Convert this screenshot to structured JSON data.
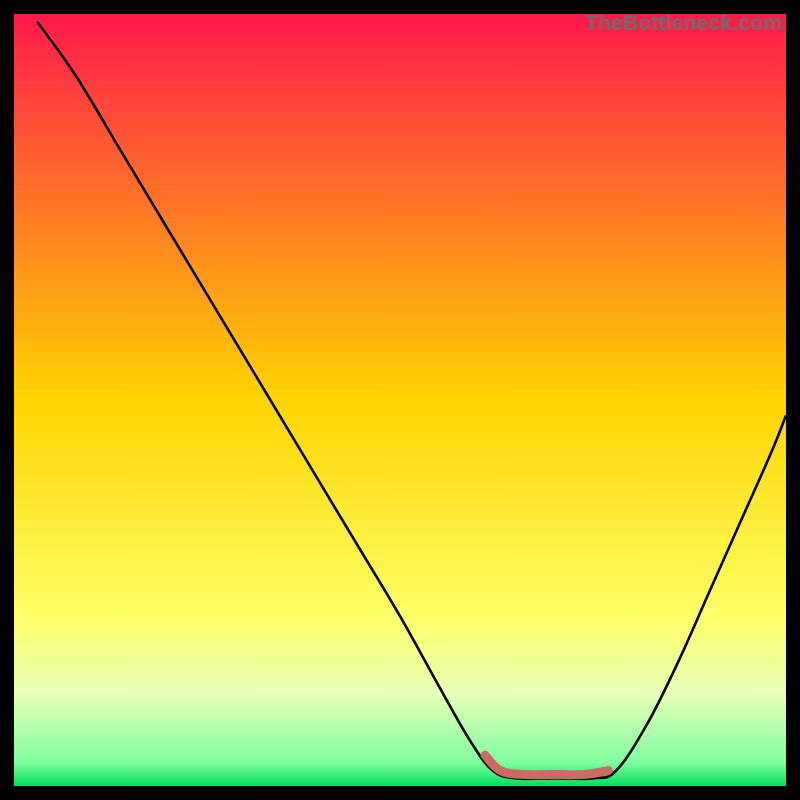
{
  "watermark": {
    "text": "TheBottleneck.com"
  },
  "chart_data": {
    "type": "line",
    "title": "",
    "xlabel": "",
    "ylabel": "",
    "xlim": [
      0,
      100
    ],
    "ylim": [
      0,
      100
    ],
    "grid": false,
    "background_gradient": {
      "stops": [
        {
          "pos": 0.0,
          "color": "#ff1a4b"
        },
        {
          "pos": 0.5,
          "color": "#ffd400"
        },
        {
          "pos": 0.78,
          "color": "#ffff66"
        },
        {
          "pos": 0.88,
          "color": "#e8ffb8"
        },
        {
          "pos": 0.97,
          "color": "#7fff9e"
        },
        {
          "pos": 1.0,
          "color": "#00e05a"
        }
      ]
    },
    "series": [
      {
        "name": "bottleneck-curve",
        "stroke": "#000000",
        "points": [
          {
            "x": 3,
            "y": 99
          },
          {
            "x": 8,
            "y": 92
          },
          {
            "x": 14,
            "y": 82
          },
          {
            "x": 20,
            "y": 72
          },
          {
            "x": 26,
            "y": 62
          },
          {
            "x": 32,
            "y": 52
          },
          {
            "x": 38,
            "y": 42
          },
          {
            "x": 44,
            "y": 32
          },
          {
            "x": 50,
            "y": 22
          },
          {
            "x": 55,
            "y": 13
          },
          {
            "x": 59,
            "y": 6
          },
          {
            "x": 62,
            "y": 2
          },
          {
            "x": 65,
            "y": 1
          },
          {
            "x": 70,
            "y": 1
          },
          {
            "x": 75,
            "y": 1
          },
          {
            "x": 78,
            "y": 2
          },
          {
            "x": 82,
            "y": 8
          },
          {
            "x": 86,
            "y": 16
          },
          {
            "x": 90,
            "y": 25
          },
          {
            "x": 94,
            "y": 34
          },
          {
            "x": 98,
            "y": 43
          },
          {
            "x": 100,
            "y": 48
          }
        ]
      },
      {
        "name": "optimal-band",
        "stroke": "#cc6a66",
        "stroke_width": 9,
        "points": [
          {
            "x": 61,
            "y": 4
          },
          {
            "x": 63,
            "y": 2
          },
          {
            "x": 66,
            "y": 1.5
          },
          {
            "x": 70,
            "y": 1.5
          },
          {
            "x": 74,
            "y": 1.5
          },
          {
            "x": 77,
            "y": 2
          }
        ]
      }
    ]
  }
}
